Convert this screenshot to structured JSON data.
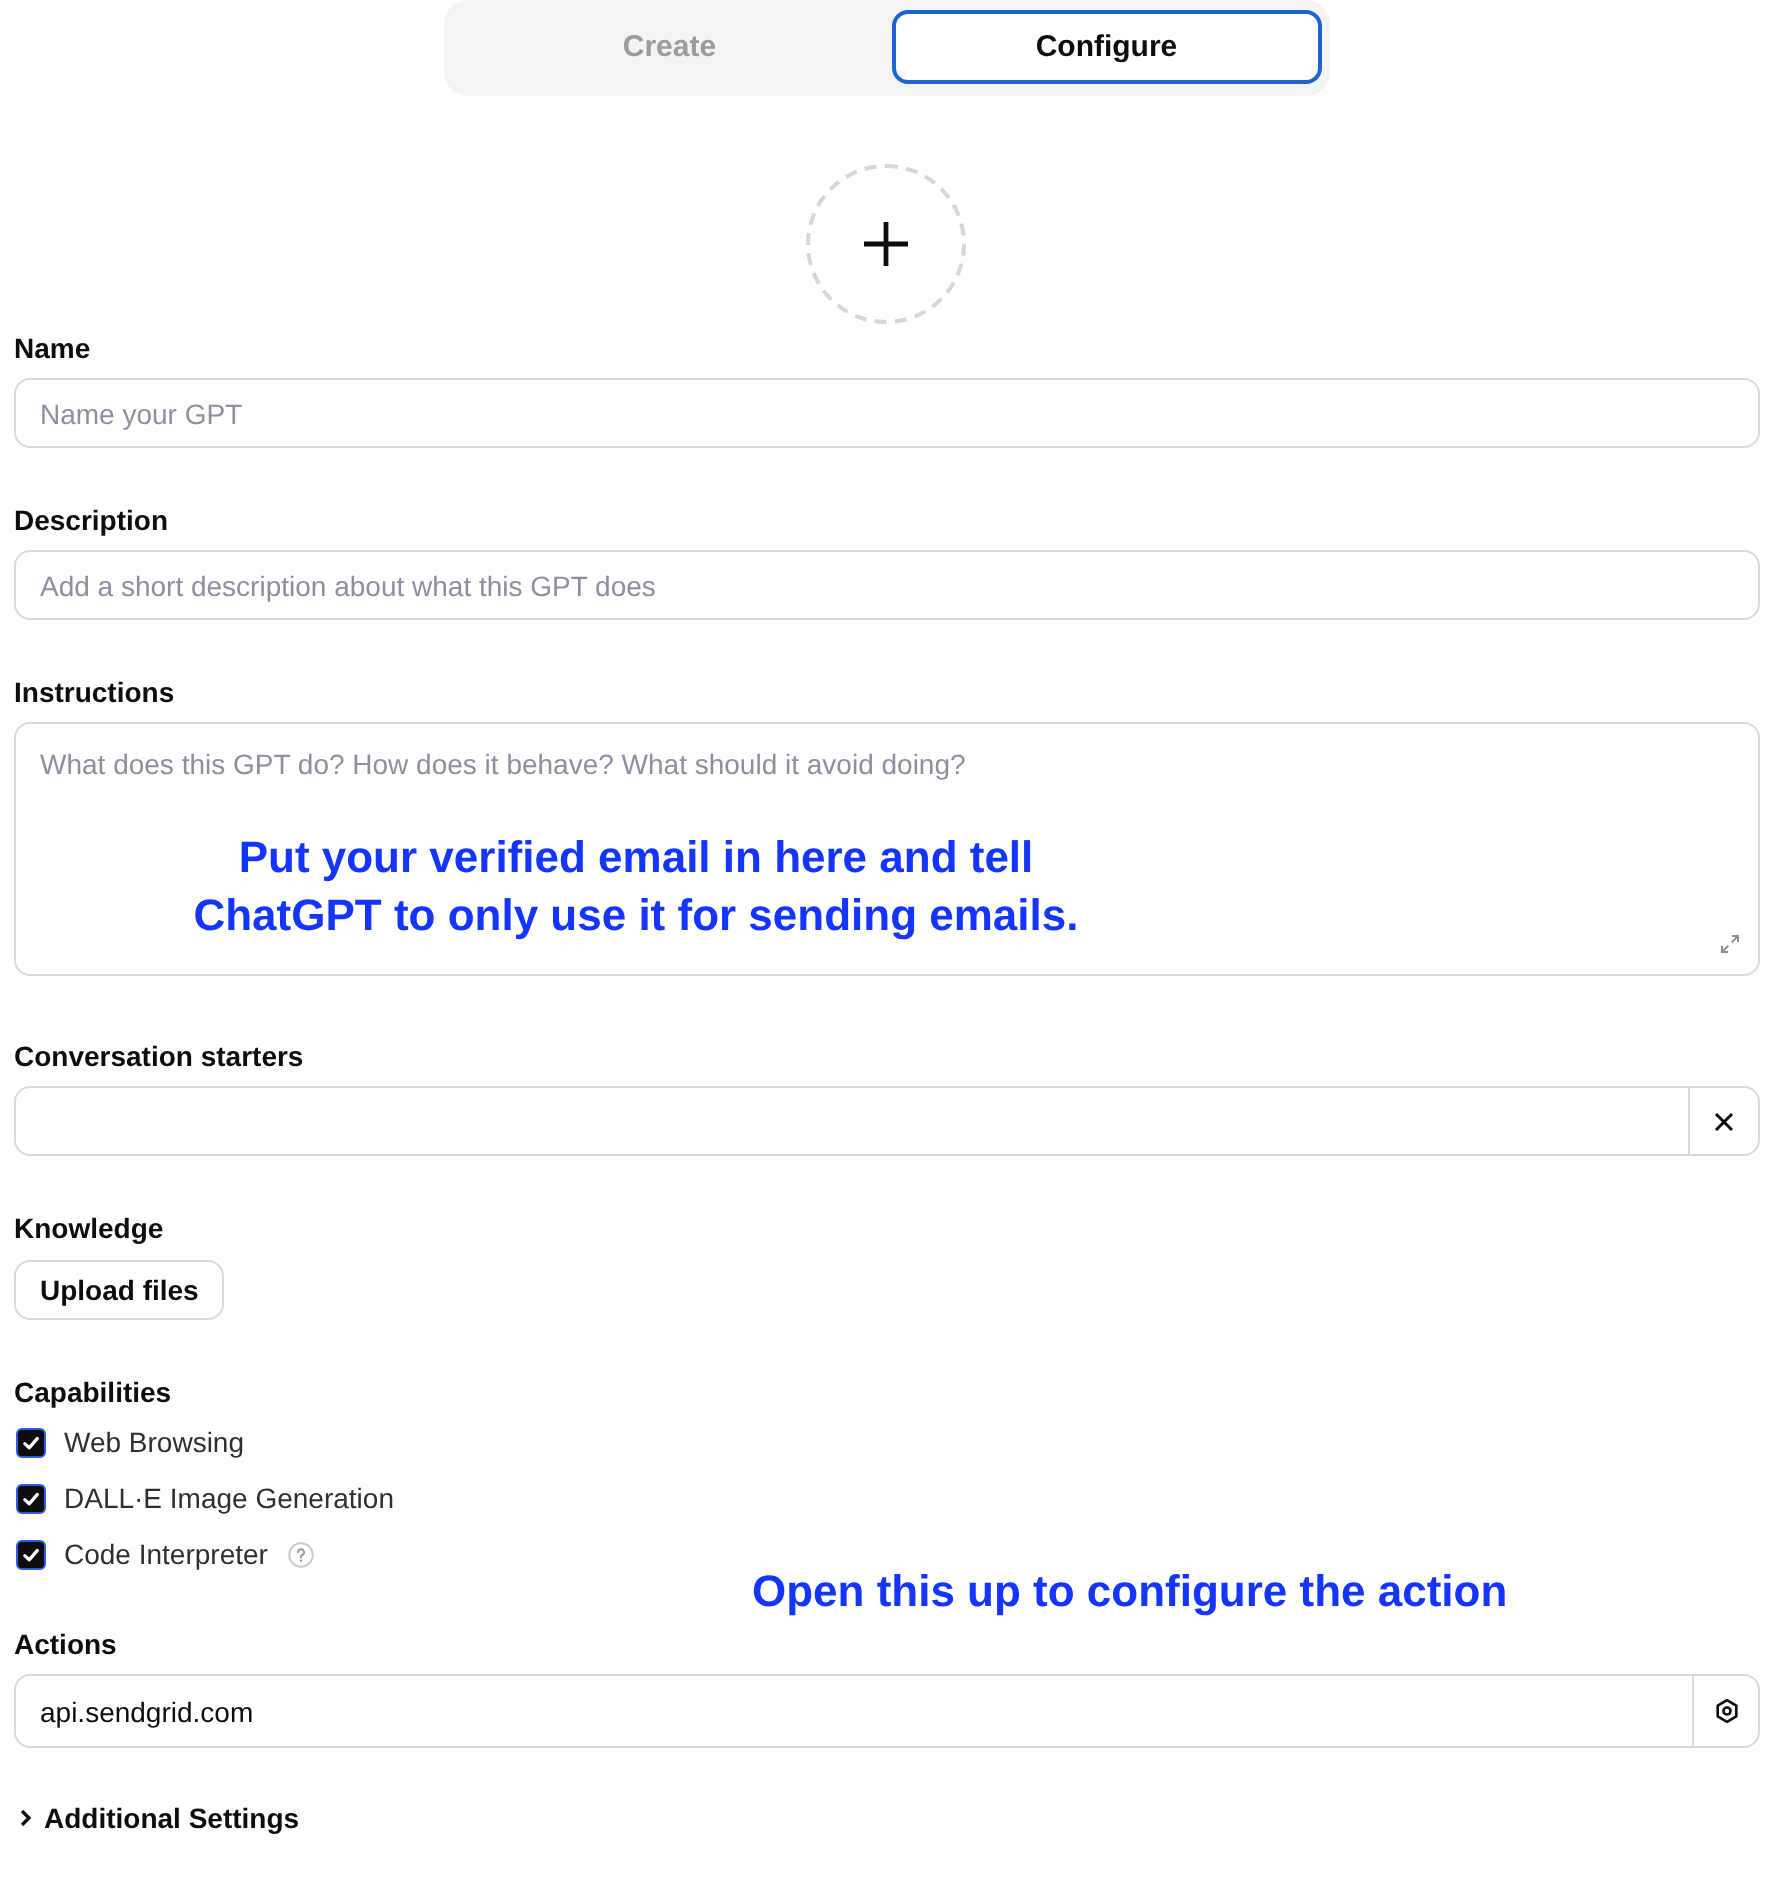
{
  "tabs": [
    {
      "label": "Create",
      "selected": false
    },
    {
      "label": "Configure",
      "selected": true
    }
  ],
  "name": {
    "label": "Name",
    "placeholder": "Name your GPT"
  },
  "description": {
    "label": "Description",
    "placeholder": "Add a short description about what this GPT does"
  },
  "instructions": {
    "label": "Instructions",
    "placeholder": "What does this GPT do? How does it behave? What should it avoid doing?",
    "note": "Put your verified email in here and tell\nChatGPT to only use it for sending emails."
  },
  "conversation_starters": {
    "label": "Conversation starters"
  },
  "knowledge": {
    "label": "Knowledge",
    "button": "Upload files"
  },
  "capabilities": {
    "label": "Capabilities",
    "items": [
      {
        "label": "Web Browsing",
        "checked": true,
        "help": false
      },
      {
        "label": "DALL·E Image Generation",
        "checked": true,
        "help": false
      },
      {
        "label": "Code Interpreter",
        "checked": true,
        "help": true
      }
    ]
  },
  "actions": {
    "label": "Actions",
    "value": "api.sendgrid.com",
    "note": "Open this up to configure the action"
  },
  "additional_settings": {
    "label": "Additional Settings",
    "expanded": false
  }
}
